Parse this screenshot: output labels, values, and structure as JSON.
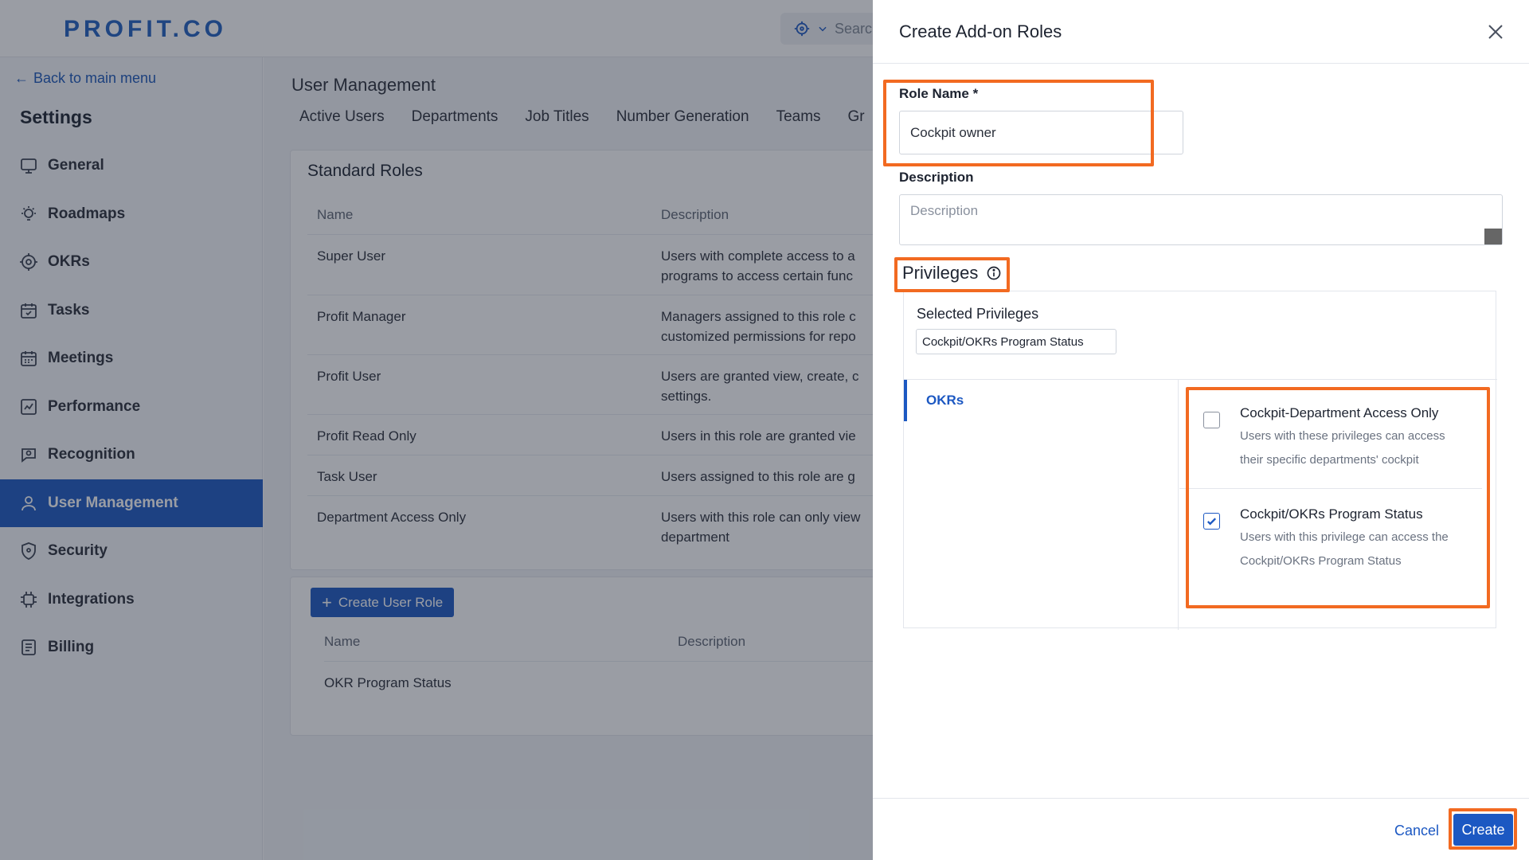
{
  "app": {
    "logo": "PROFIT.CO",
    "search_placeholder": "Searc"
  },
  "sidebar": {
    "back_label": "Back to main menu",
    "title": "Settings",
    "items": [
      {
        "label": "General",
        "icon": "monitor-icon"
      },
      {
        "label": "Roadmaps",
        "icon": "lightbulb-icon"
      },
      {
        "label": "OKRs",
        "icon": "target-icon"
      },
      {
        "label": "Tasks",
        "icon": "calendar-check-icon"
      },
      {
        "label": "Meetings",
        "icon": "calendar-icon"
      },
      {
        "label": "Performance",
        "icon": "chart-icon"
      },
      {
        "label": "Recognition",
        "icon": "recognition-icon"
      },
      {
        "label": "User Management",
        "icon": "user-icon",
        "active": true
      },
      {
        "label": "Security",
        "icon": "shield-icon"
      },
      {
        "label": "Integrations",
        "icon": "chip-icon"
      },
      {
        "label": "Billing",
        "icon": "document-icon"
      }
    ]
  },
  "main": {
    "title": "User Management",
    "tabs": [
      "Active Users",
      "Departments",
      "Job Titles",
      "Number Generation",
      "Teams",
      "Gr"
    ],
    "standard_roles": {
      "title": "Standard Roles",
      "columns": [
        "Name",
        "Description"
      ],
      "rows": [
        {
          "name": "Super User",
          "desc_1": "Users with complete access to a",
          "desc_2": "programs to access certain func"
        },
        {
          "name": "Profit Manager",
          "desc_1": "Managers assigned to this role c",
          "desc_2": "customized permissions for repo"
        },
        {
          "name": "Profit User",
          "desc_1": "Users are granted view, create, c",
          "desc_2": "settings."
        },
        {
          "name": "Profit Read Only",
          "desc_1": "Users in this role are granted vie",
          "desc_2": ""
        },
        {
          "name": "Task User",
          "desc_1": "Users assigned to this role are g",
          "desc_2": ""
        },
        {
          "name": "Department Access Only",
          "desc_1": "Users with this role can only view",
          "desc_2": "department"
        }
      ]
    },
    "custom_roles": {
      "create_label": "Create User Role",
      "columns": [
        "Name",
        "Description"
      ],
      "rows": [
        {
          "name": "OKR Program Status",
          "desc": ""
        }
      ]
    }
  },
  "drawer": {
    "title": "Create Add-on Roles",
    "role_name_label": "Role Name *",
    "role_name_value": "Cockpit owner",
    "description_label": "Description",
    "description_placeholder": "Description",
    "privileges_title": "Privileges",
    "selected_privileges_label": "Selected Privileges",
    "selected_chip": "Cockpit/OKRs Program Status",
    "category": "OKRs",
    "options": [
      {
        "title": "Cockpit-Department Access Only",
        "desc_1": "Users with these privileges can access",
        "desc_2": "their specific departments' cockpit",
        "checked": false
      },
      {
        "title": "Cockpit/OKRs Program Status",
        "desc_1": "Users with this privilege can access the",
        "desc_2": "Cockpit/OKRs Program Status",
        "checked": true
      }
    ],
    "cancel_label": "Cancel",
    "create_label": "Create"
  },
  "colors": {
    "accent": "#1c58c2",
    "highlight": "#f26a21"
  }
}
